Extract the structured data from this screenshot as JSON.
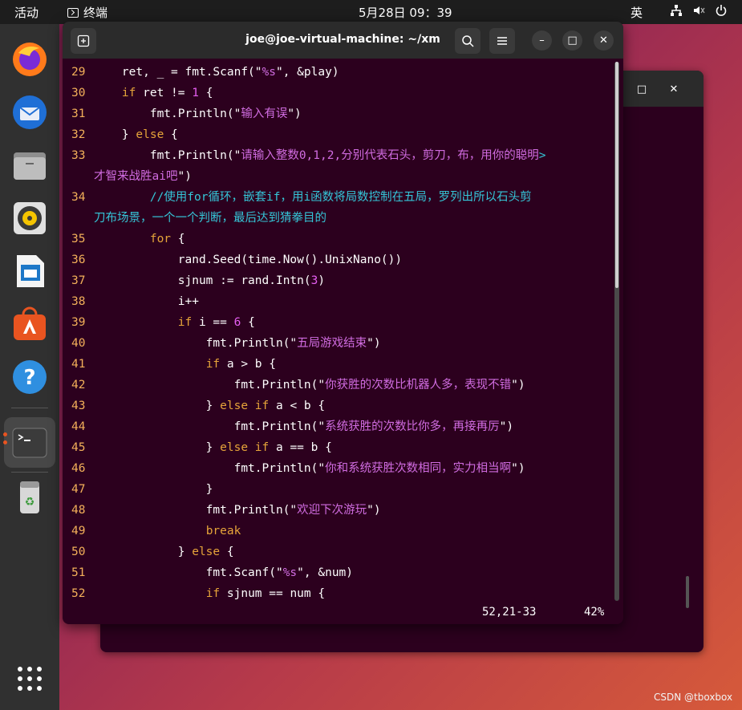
{
  "topbar": {
    "activities": "活动",
    "app_name": "终端",
    "clock": "5月28日  09：39",
    "ime": "英",
    "tray_icons": [
      "network-icon",
      "volume-muted-icon",
      "power-icon"
    ]
  },
  "window": {
    "title": "joe@joe-virtual-machine: ~/xm",
    "new_tab_icon": "new-tab-icon",
    "search_icon": "search-icon",
    "menu_icon": "hamburger-menu-icon",
    "minimize": "–",
    "maximize": "□",
    "close": "✕"
  },
  "back_window": {
    "maximize": "□",
    "close": "✕"
  },
  "editor": {
    "lines": [
      {
        "n": "29",
        "text": "    ret, _ = fmt.Scanf(\"%s\", &play)"
      },
      {
        "n": "30",
        "text": "    if ret != 1 {"
      },
      {
        "n": "31",
        "text": "        fmt.Println(\"输入有误\")"
      },
      {
        "n": "32",
        "text": "    } else {"
      },
      {
        "n": "33",
        "text": "        fmt.Println(\"请输入整数0,1,2,分别代表石头，剪刀，布，用你的聪明>",
        "wrap": "才智来战胜ai吧\")"
      },
      {
        "n": "34",
        "text": "        //使用for循环，嵌套if，用i函数将局数控制在五局，罗列出所以石头剪",
        "wrap": "刀布场景，一个一个判断，最后达到猜拳目的"
      },
      {
        "n": "35",
        "text": "        for {"
      },
      {
        "n": "36",
        "text": "            rand.Seed(time.Now().UnixNano())"
      },
      {
        "n": "37",
        "text": "            sjnum := rand.Intn(3)"
      },
      {
        "n": "38",
        "text": "            i++"
      },
      {
        "n": "39",
        "text": "            if i == 6 {"
      },
      {
        "n": "40",
        "text": "                fmt.Println(\"五局游戏结束\")"
      },
      {
        "n": "41",
        "text": "                if a > b {"
      },
      {
        "n": "42",
        "text": "                    fmt.Println(\"你获胜的次数比机器人多，表现不错\")"
      },
      {
        "n": "43",
        "text": "                } else if a < b {"
      },
      {
        "n": "44",
        "text": "                    fmt.Println(\"系统获胜的次数比你多，再接再厉\")"
      },
      {
        "n": "45",
        "text": "                } else if a == b {"
      },
      {
        "n": "46",
        "text": "                    fmt.Println(\"你和系统获胜次数相同，实力相当啊\")"
      },
      {
        "n": "47",
        "text": "                }"
      },
      {
        "n": "48",
        "text": "                fmt.Println(\"欢迎下次游玩\")"
      },
      {
        "n": "49",
        "text": "                break"
      },
      {
        "n": "50",
        "text": "            } else {"
      },
      {
        "n": "51",
        "text": "                fmt.Scanf(\"%s\", &num)"
      },
      {
        "n": "52",
        "text": "                if sjnum == num {"
      }
    ],
    "cursor_pos": "52,21-33",
    "scroll_percent": "42%"
  },
  "dock": {
    "items": [
      "firefox-icon",
      "thunderbird-icon",
      "files-icon",
      "rhythmbox-icon",
      "libreoffice-writer-icon",
      "app-center-icon",
      "help-icon",
      "terminal-icon",
      "trash-icon",
      "show-apps-icon"
    ]
  },
  "watermark": "CSDN @tboxbox",
  "colors": {
    "terminal_bg": "#2c001e",
    "keyword": "#e6a43a",
    "string": "#d06ce0",
    "comment": "#35c6d8",
    "line_number": "#f3b05a",
    "accent": "#e95420"
  }
}
